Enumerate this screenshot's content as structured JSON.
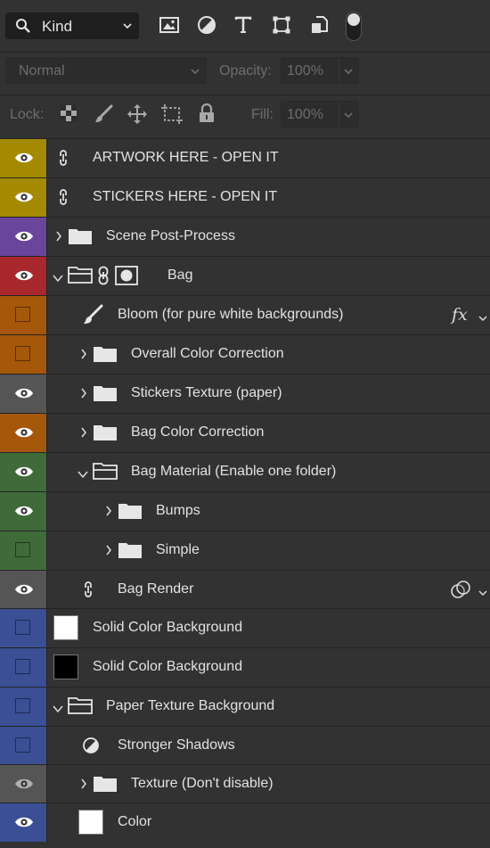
{
  "filter_bar": {
    "kind_label": "Kind",
    "filter_icons": [
      "image-filter-icon",
      "adjustment-filter-icon",
      "type-filter-icon",
      "shape-filter-icon",
      "smart-object-filter-icon"
    ],
    "toggle_on": true
  },
  "blend_bar": {
    "mode": "Normal",
    "opacity_label": "Opacity:",
    "opacity_value": "100%"
  },
  "lock_bar": {
    "lock_label": "Lock:",
    "fill_label": "Fill:",
    "fill_value": "100%"
  },
  "layers": [
    {
      "name": "ARTWORK HERE - OPEN IT",
      "color": "#a38a00",
      "visible": true,
      "indent": 0,
      "type": "smart"
    },
    {
      "name": "STICKERS HERE - OPEN IT",
      "color": "#a38a00",
      "visible": true,
      "indent": 0,
      "type": "smart"
    },
    {
      "name": "Scene Post-Process",
      "color": "#6a459c",
      "visible": true,
      "indent": 0,
      "type": "group",
      "expanded": false
    },
    {
      "name": "Bag",
      "color": "#a8272d",
      "visible": true,
      "indent": 0,
      "type": "group-mask",
      "expanded": true
    },
    {
      "name": "Bloom (for pure white backgrounds)",
      "color": "#a5570a",
      "visible": false,
      "indent": 1,
      "type": "brush",
      "fx": "fx"
    },
    {
      "name": "Overall Color Correction",
      "color": "#a5570a",
      "visible": false,
      "indent": 1,
      "type": "group",
      "expanded": false
    },
    {
      "name": "Stickers Texture (paper)",
      "color": "#555555",
      "visible": true,
      "indent": 1,
      "type": "group",
      "expanded": false
    },
    {
      "name": "Bag Color Correction",
      "color": "#a5570a",
      "visible": true,
      "indent": 1,
      "type": "group",
      "expanded": false
    },
    {
      "name": "Bag Material (Enable one folder)",
      "color": "#3e6b38",
      "visible": true,
      "indent": 1,
      "type": "group",
      "expanded": true
    },
    {
      "name": "Bumps",
      "color": "#3e6b38",
      "visible": true,
      "indent": 2,
      "type": "group",
      "expanded": false
    },
    {
      "name": "Simple",
      "color": "#3e6b38",
      "visible": false,
      "indent": 2,
      "type": "group",
      "expanded": false
    },
    {
      "name": "Bag Render",
      "color": "#555555",
      "visible": true,
      "indent": 1,
      "type": "smart",
      "blend_icon": true
    },
    {
      "name": "Solid Color Background",
      "color": "#3a4f94",
      "visible": false,
      "indent": 0,
      "type": "fill",
      "swatch": "#ffffff"
    },
    {
      "name": "Solid Color Background",
      "color": "#3a4f94",
      "visible": false,
      "indent": 0,
      "type": "fill",
      "swatch": "#000000"
    },
    {
      "name": "Paper Texture Background",
      "color": "#3a4f94",
      "visible": false,
      "indent": 0,
      "type": "group",
      "expanded": true
    },
    {
      "name": "Stronger Shadows",
      "color": "#3a4f94",
      "visible": false,
      "indent": 1,
      "type": "adjust"
    },
    {
      "name": "Texture (Don't disable)",
      "color": "#555555",
      "visible": true,
      "dim": true,
      "indent": 1,
      "type": "group",
      "expanded": false
    },
    {
      "name": "Color",
      "color": "#3a4f94",
      "visible": true,
      "indent": 1,
      "type": "fill",
      "swatch": "#ffffff"
    }
  ]
}
